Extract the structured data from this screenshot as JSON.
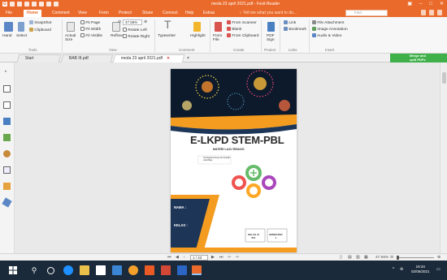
{
  "window": {
    "title": "meda 23 april 2021.pdf - Foxit Reader"
  },
  "menu": {
    "items": [
      "File",
      "Home",
      "Comment",
      "View",
      "Form",
      "Protect",
      "Share",
      "Connect",
      "Help",
      "Extras"
    ],
    "active": "Home",
    "tell_me": "Tell me what you want to do...",
    "find_placeholder": "Find"
  },
  "ribbon": {
    "tools": {
      "hand": "Hand",
      "select": "Select",
      "snapshot": "SnapShot",
      "clipboard": "Clipboard",
      "group": "Tools"
    },
    "view": {
      "actual_size": "Actual Size",
      "fit_page": "Fit Page",
      "fit_width": "Fit Width",
      "fit_visible": "Fit Visible",
      "reflow": "Reflow",
      "zoom": "47.56%",
      "rotate_left": "Rotate Left",
      "rotate_right": "Rotate Right",
      "group": "View"
    },
    "comment": {
      "typewriter": "Typewriter",
      "highlight": "Highlight",
      "group": "Comment"
    },
    "create": {
      "from_file": "From File",
      "from_scanner": "From Scanner",
      "blank": "Blank",
      "from_clipboard": "From Clipboard",
      "group": "Create"
    },
    "protect": {
      "pdf_sign": "PDF Sign",
      "group": "Protect"
    },
    "links": {
      "link": "Link",
      "bookmark": "Bookmark",
      "group": "Links"
    },
    "insert": {
      "file_attachment": "File Attachment",
      "image_annotation": "Image Annotation",
      "audio_video": "Audio & Video",
      "group": "Insert"
    }
  },
  "tabs": [
    {
      "label": "Start"
    },
    {
      "label": "BAB III.pdf"
    },
    {
      "label": "meda 23 april 2021.pdf"
    }
  ],
  "merge_button": {
    "line1": "Merge and",
    "line2": "split PDFs"
  },
  "document": {
    "title": "E-LKPD STEM-PBL",
    "subtitle": "MATERI LAJU REAKSI",
    "note": "Terintegrasi konsep dan Kearifan Lokal Meja",
    "name_label": "NAMA :",
    "class_field_label": "KELAS :",
    "class_box": "KELAS XI\nIPA",
    "semester_box": "SEMESTER\n1"
  },
  "statusbar": {
    "page": "1 / 43",
    "zoom": "47.56%"
  },
  "taskbar": {
    "time": "19:34",
    "date": "02/06/2021"
  },
  "colors": {
    "accent": "#ea6a2b",
    "merge": "#3fb04a",
    "taskbar": "#1b2a3a"
  }
}
